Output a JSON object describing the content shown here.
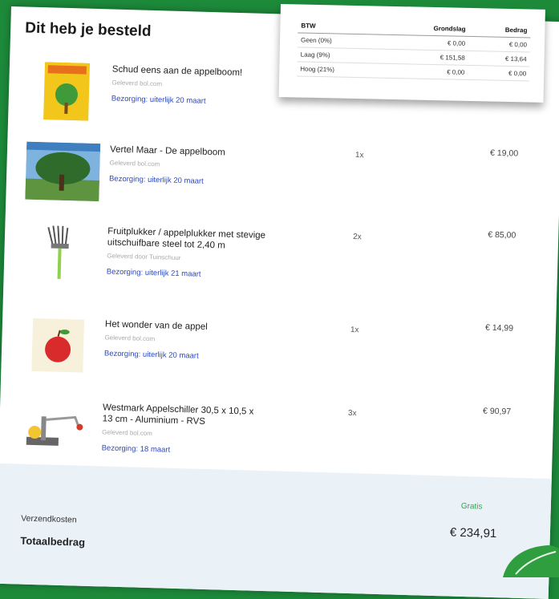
{
  "page": {
    "title": "Dit heb je besteld"
  },
  "products": [
    {
      "name": "Schud eens aan de appelboom!",
      "seller": "Geleverd bol.com",
      "delivery": "Bezorging: uiterlijk 20 maart",
      "qty": "",
      "price": "",
      "image": "book-yellow-tree"
    },
    {
      "name": "Vertel Maar - De appelboom",
      "seller": "Geleverd bol.com",
      "delivery": "Bezorging: uiterlijk 20 maart",
      "qty": "1x",
      "price": "€ 19,00",
      "image": "book-apple-tree"
    },
    {
      "name": "Fruitplukker / appelplukker met stevige uitschuifbare steel tot 2,40 m",
      "seller": "Geleverd door Tuinschuur",
      "delivery": "Bezorging: uiterlijk 21 maart",
      "qty": "2x",
      "price": "€ 85,00",
      "image": "fruit-picker"
    },
    {
      "name": "Het wonder van de appel",
      "seller": "Geleverd bol.com",
      "delivery": "Bezorging: uiterlijk 20 maart",
      "qty": "1x",
      "price": "€ 14,99",
      "image": "book-red-apple"
    },
    {
      "name": "Westmark Appelschiller 30,5 x 10,5 x 13 cm - Aluminium - RVS",
      "seller": "Geleverd bol.com",
      "delivery": "Bezorging: 18 maart",
      "qty": "3x",
      "price": "€ 90,97",
      "image": "apple-peeler"
    }
  ],
  "btw_table": {
    "headers": [
      "BTW",
      "Grondslag",
      "Bedrag"
    ],
    "rows": [
      [
        "Geen (0%)",
        "€ 0,00",
        "€ 0,00"
      ],
      [
        "Laag (9%)",
        "€ 151,58",
        "€ 13,64"
      ],
      [
        "Hoog (21%)",
        "€ 0,00",
        "€ 0,00"
      ]
    ]
  },
  "summary": {
    "shipping_label": "Verzendkosten",
    "shipping_value": "Gratis",
    "total_label": "Totaalbedrag",
    "total_value": "€ 234,91"
  },
  "colors": {
    "background": "#1d8a3a",
    "link": "#2a48c8",
    "free": "#28a84a",
    "footer": "#eaf2f8"
  }
}
